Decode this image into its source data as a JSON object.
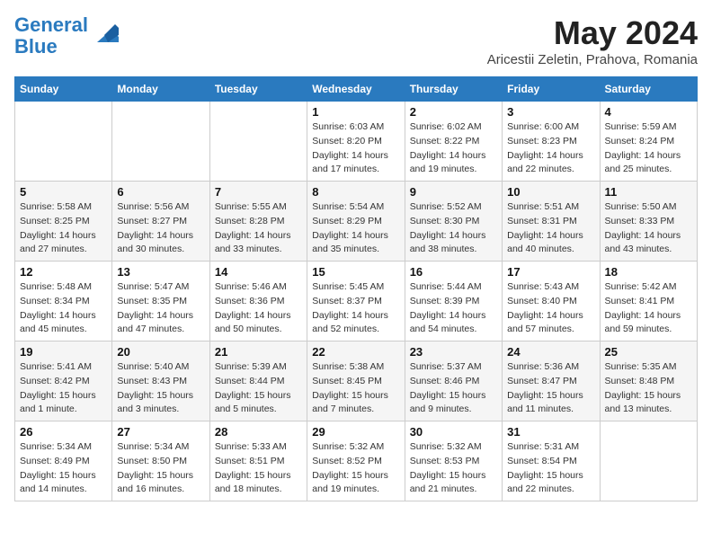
{
  "header": {
    "logo_line1": "General",
    "logo_line2": "Blue",
    "month": "May 2024",
    "location": "Aricestii Zeletin, Prahova, Romania"
  },
  "days_of_week": [
    "Sunday",
    "Monday",
    "Tuesday",
    "Wednesday",
    "Thursday",
    "Friday",
    "Saturday"
  ],
  "weeks": [
    [
      {
        "day": "",
        "sunrise": "",
        "sunset": "",
        "daylight": ""
      },
      {
        "day": "",
        "sunrise": "",
        "sunset": "",
        "daylight": ""
      },
      {
        "day": "",
        "sunrise": "",
        "sunset": "",
        "daylight": ""
      },
      {
        "day": "1",
        "sunrise": "Sunrise: 6:03 AM",
        "sunset": "Sunset: 8:20 PM",
        "daylight": "Daylight: 14 hours and 17 minutes."
      },
      {
        "day": "2",
        "sunrise": "Sunrise: 6:02 AM",
        "sunset": "Sunset: 8:22 PM",
        "daylight": "Daylight: 14 hours and 19 minutes."
      },
      {
        "day": "3",
        "sunrise": "Sunrise: 6:00 AM",
        "sunset": "Sunset: 8:23 PM",
        "daylight": "Daylight: 14 hours and 22 minutes."
      },
      {
        "day": "4",
        "sunrise": "Sunrise: 5:59 AM",
        "sunset": "Sunset: 8:24 PM",
        "daylight": "Daylight: 14 hours and 25 minutes."
      }
    ],
    [
      {
        "day": "5",
        "sunrise": "Sunrise: 5:58 AM",
        "sunset": "Sunset: 8:25 PM",
        "daylight": "Daylight: 14 hours and 27 minutes."
      },
      {
        "day": "6",
        "sunrise": "Sunrise: 5:56 AM",
        "sunset": "Sunset: 8:27 PM",
        "daylight": "Daylight: 14 hours and 30 minutes."
      },
      {
        "day": "7",
        "sunrise": "Sunrise: 5:55 AM",
        "sunset": "Sunset: 8:28 PM",
        "daylight": "Daylight: 14 hours and 33 minutes."
      },
      {
        "day": "8",
        "sunrise": "Sunrise: 5:54 AM",
        "sunset": "Sunset: 8:29 PM",
        "daylight": "Daylight: 14 hours and 35 minutes."
      },
      {
        "day": "9",
        "sunrise": "Sunrise: 5:52 AM",
        "sunset": "Sunset: 8:30 PM",
        "daylight": "Daylight: 14 hours and 38 minutes."
      },
      {
        "day": "10",
        "sunrise": "Sunrise: 5:51 AM",
        "sunset": "Sunset: 8:31 PM",
        "daylight": "Daylight: 14 hours and 40 minutes."
      },
      {
        "day": "11",
        "sunrise": "Sunrise: 5:50 AM",
        "sunset": "Sunset: 8:33 PM",
        "daylight": "Daylight: 14 hours and 43 minutes."
      }
    ],
    [
      {
        "day": "12",
        "sunrise": "Sunrise: 5:48 AM",
        "sunset": "Sunset: 8:34 PM",
        "daylight": "Daylight: 14 hours and 45 minutes."
      },
      {
        "day": "13",
        "sunrise": "Sunrise: 5:47 AM",
        "sunset": "Sunset: 8:35 PM",
        "daylight": "Daylight: 14 hours and 47 minutes."
      },
      {
        "day": "14",
        "sunrise": "Sunrise: 5:46 AM",
        "sunset": "Sunset: 8:36 PM",
        "daylight": "Daylight: 14 hours and 50 minutes."
      },
      {
        "day": "15",
        "sunrise": "Sunrise: 5:45 AM",
        "sunset": "Sunset: 8:37 PM",
        "daylight": "Daylight: 14 hours and 52 minutes."
      },
      {
        "day": "16",
        "sunrise": "Sunrise: 5:44 AM",
        "sunset": "Sunset: 8:39 PM",
        "daylight": "Daylight: 14 hours and 54 minutes."
      },
      {
        "day": "17",
        "sunrise": "Sunrise: 5:43 AM",
        "sunset": "Sunset: 8:40 PM",
        "daylight": "Daylight: 14 hours and 57 minutes."
      },
      {
        "day": "18",
        "sunrise": "Sunrise: 5:42 AM",
        "sunset": "Sunset: 8:41 PM",
        "daylight": "Daylight: 14 hours and 59 minutes."
      }
    ],
    [
      {
        "day": "19",
        "sunrise": "Sunrise: 5:41 AM",
        "sunset": "Sunset: 8:42 PM",
        "daylight": "Daylight: 15 hours and 1 minute."
      },
      {
        "day": "20",
        "sunrise": "Sunrise: 5:40 AM",
        "sunset": "Sunset: 8:43 PM",
        "daylight": "Daylight: 15 hours and 3 minutes."
      },
      {
        "day": "21",
        "sunrise": "Sunrise: 5:39 AM",
        "sunset": "Sunset: 8:44 PM",
        "daylight": "Daylight: 15 hours and 5 minutes."
      },
      {
        "day": "22",
        "sunrise": "Sunrise: 5:38 AM",
        "sunset": "Sunset: 8:45 PM",
        "daylight": "Daylight: 15 hours and 7 minutes."
      },
      {
        "day": "23",
        "sunrise": "Sunrise: 5:37 AM",
        "sunset": "Sunset: 8:46 PM",
        "daylight": "Daylight: 15 hours and 9 minutes."
      },
      {
        "day": "24",
        "sunrise": "Sunrise: 5:36 AM",
        "sunset": "Sunset: 8:47 PM",
        "daylight": "Daylight: 15 hours and 11 minutes."
      },
      {
        "day": "25",
        "sunrise": "Sunrise: 5:35 AM",
        "sunset": "Sunset: 8:48 PM",
        "daylight": "Daylight: 15 hours and 13 minutes."
      }
    ],
    [
      {
        "day": "26",
        "sunrise": "Sunrise: 5:34 AM",
        "sunset": "Sunset: 8:49 PM",
        "daylight": "Daylight: 15 hours and 14 minutes."
      },
      {
        "day": "27",
        "sunrise": "Sunrise: 5:34 AM",
        "sunset": "Sunset: 8:50 PM",
        "daylight": "Daylight: 15 hours and 16 minutes."
      },
      {
        "day": "28",
        "sunrise": "Sunrise: 5:33 AM",
        "sunset": "Sunset: 8:51 PM",
        "daylight": "Daylight: 15 hours and 18 minutes."
      },
      {
        "day": "29",
        "sunrise": "Sunrise: 5:32 AM",
        "sunset": "Sunset: 8:52 PM",
        "daylight": "Daylight: 15 hours and 19 minutes."
      },
      {
        "day": "30",
        "sunrise": "Sunrise: 5:32 AM",
        "sunset": "Sunset: 8:53 PM",
        "daylight": "Daylight: 15 hours and 21 minutes."
      },
      {
        "day": "31",
        "sunrise": "Sunrise: 5:31 AM",
        "sunset": "Sunset: 8:54 PM",
        "daylight": "Daylight: 15 hours and 22 minutes."
      },
      {
        "day": "",
        "sunrise": "",
        "sunset": "",
        "daylight": ""
      }
    ]
  ]
}
